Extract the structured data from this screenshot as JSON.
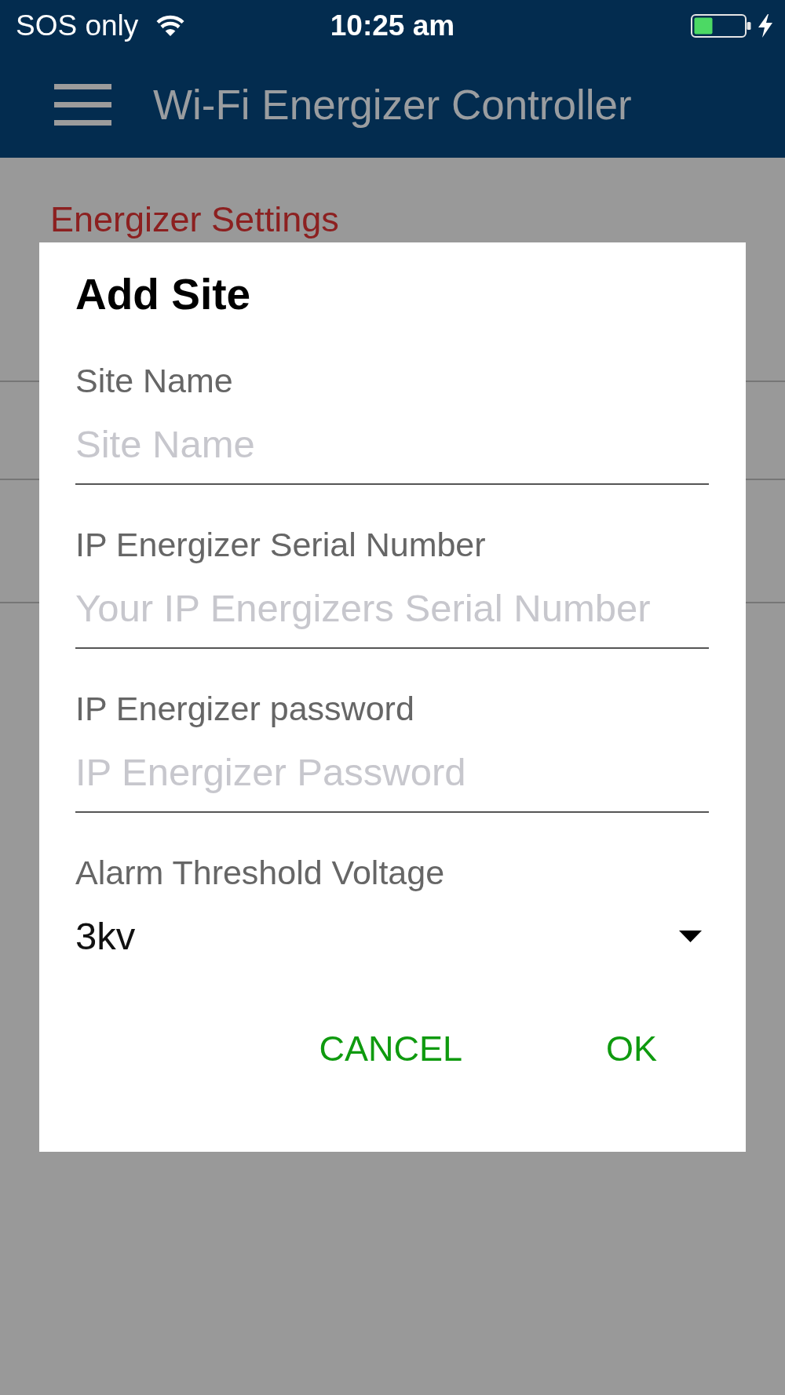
{
  "status_bar": {
    "carrier": "SOS only",
    "time": "10:25 am"
  },
  "app_bar": {
    "title": "Wi-Fi Energizer Controller"
  },
  "page": {
    "section_title": "Energizer Settings"
  },
  "dialog": {
    "title": "Add Site",
    "fields": [
      {
        "kind": "text",
        "label": "Site Name",
        "placeholder": "Site Name"
      },
      {
        "kind": "text",
        "label": "IP Energizer Serial Number",
        "placeholder": "Your IP Energizers Serial Number"
      },
      {
        "kind": "password",
        "label": "IP Energizer password",
        "placeholder": "IP Energizer Password"
      },
      {
        "kind": "select",
        "label": "Alarm Threshold Voltage",
        "value": "3kv"
      }
    ],
    "buttons": [
      "CANCEL",
      "OK"
    ]
  }
}
